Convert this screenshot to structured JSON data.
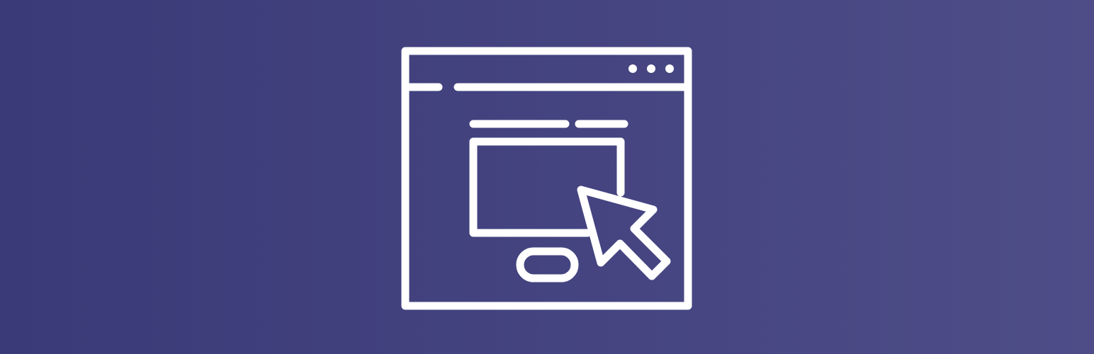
{
  "banner": {
    "icon_name": "browser-window-click-icon",
    "background_start": "#3a3a78",
    "background_end": "#4e4d88",
    "stroke_color": "#ffffff"
  }
}
